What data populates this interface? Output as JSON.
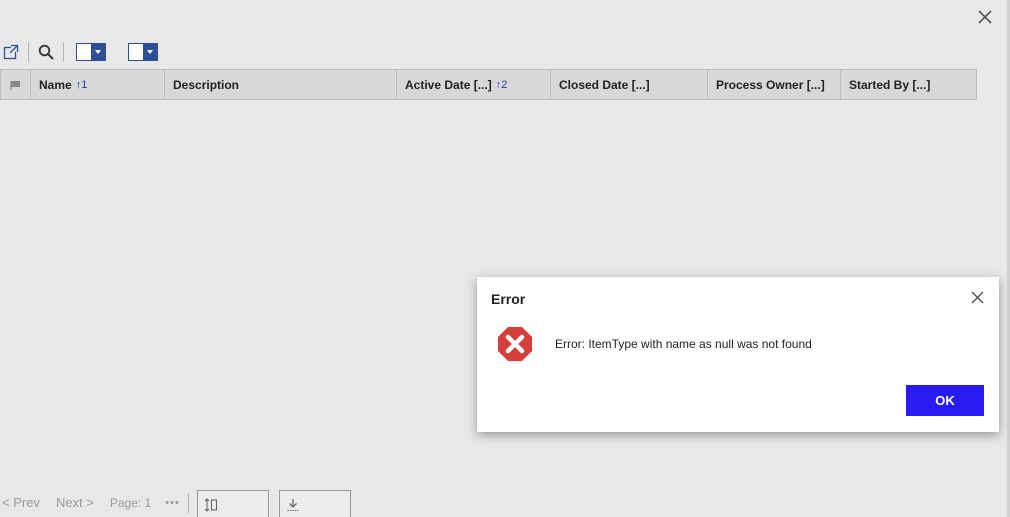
{
  "window": {
    "close_icon": "close-icon"
  },
  "toolbar": {
    "items": [
      "external-link-icon",
      "search-icon",
      "split-dropdown",
      "split-dropdown"
    ]
  },
  "grid": {
    "columns": [
      {
        "label": "Name",
        "sort": "↑1"
      },
      {
        "label": "Description",
        "sort": ""
      },
      {
        "label": "Active Date [...]",
        "sort": "↑2"
      },
      {
        "label": "Closed Date [...]",
        "sort": ""
      },
      {
        "label": "Process Owner [...]",
        "sort": ""
      },
      {
        "label": "Started By [...]",
        "sort": ""
      }
    ]
  },
  "footer": {
    "prev": "< Prev",
    "next": "Next >",
    "page": "Page: 1",
    "more": "•••"
  },
  "dialog": {
    "title": "Error",
    "message": "Error: ItemType with name as null was not found",
    "ok_label": "OK",
    "icon": "error-icon"
  },
  "colors": {
    "accent": "#2a1bf2",
    "error": "#d43f3a",
    "toolbar_blue": "#2f4f99",
    "sort_blue": "#1d3fa8"
  }
}
